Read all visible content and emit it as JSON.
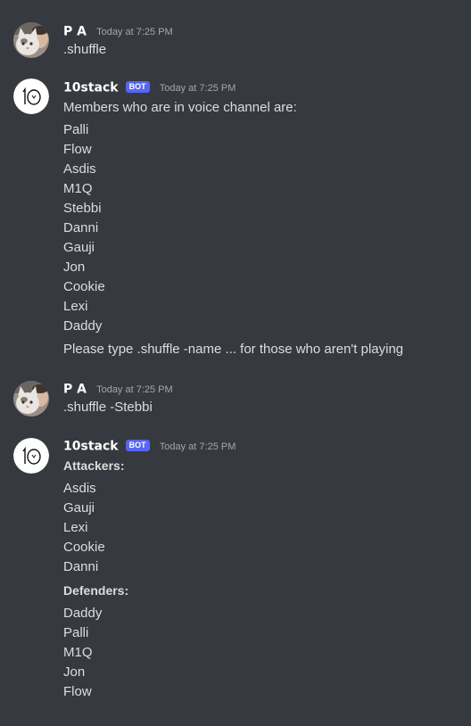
{
  "messages": [
    {
      "author": "P A",
      "timestamp": "Today at 7:25 PM",
      "avatar_icon": "cat-with-person-avatar",
      "lines": [
        ".shuffle"
      ]
    },
    {
      "author": "10stack",
      "bot_tag": "BOT",
      "timestamp": "Today at 7:25 PM",
      "avatar_icon": "10-logo-avatar",
      "lines": [
        "Members who are in voice channel are:",
        "Palli",
        "Flow",
        "Asdis",
        "M1Q",
        "Stebbi",
        "Danni",
        "Gauji",
        "Jon",
        "Cookie",
        "Lexi",
        "Daddy",
        "Please type .shuffle -name ... for those who aren't playing"
      ]
    },
    {
      "author": "P A",
      "timestamp": "Today at 7:25 PM",
      "avatar_icon": "cat-with-person-avatar",
      "lines": [
        ".shuffle -Stebbi"
      ]
    },
    {
      "author": "10stack",
      "bot_tag": "BOT",
      "timestamp": "Today at 7:25 PM",
      "avatar_icon": "10-logo-avatar",
      "lines": [
        "Attackers:",
        "Asdis",
        "Gauji",
        "Lexi",
        "Cookie",
        "Danni",
        "Defenders:",
        "Daddy",
        "Palli",
        "M1Q",
        "Jon",
        "Flow"
      ]
    }
  ],
  "colors": {
    "background": "#36393f",
    "username": "#ffffff",
    "text": "#dcddde",
    "timestamp": "#a3a6aa",
    "bot_tag": "#5865f2"
  }
}
